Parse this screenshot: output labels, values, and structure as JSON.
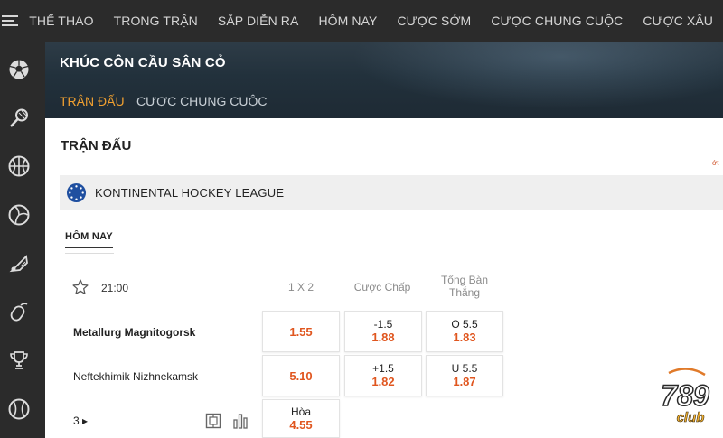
{
  "topnav": {
    "items": [
      "THỂ THAO",
      "TRONG TRẬN",
      "SẮP DIỄN RA",
      "HÔM NAY",
      "CƯỢC SỚM",
      "CƯỢC CHUNG CUỘC",
      "CƯỢC XÂU"
    ]
  },
  "sidebar": {
    "icons": [
      "soccer-ball-icon",
      "badminton-racket-icon",
      "basketball-icon",
      "volleyball-icon",
      "shuttlecock-icon",
      "computer-mouse-icon",
      "trophy-icon",
      "baseball-icon"
    ]
  },
  "banner": {
    "title": "KHÚC CÔN CẦU SÂN CỎ",
    "tabs": [
      "TRẬN ĐẤU",
      "CƯỢC CHUNG CUỘC"
    ]
  },
  "section": {
    "title": "TRẬN ĐẤU",
    "right_mark": "ớt"
  },
  "league": {
    "name": "KONTINENTAL HOCKEY LEAGUE"
  },
  "filter": {
    "today": "HÔM NAY"
  },
  "match": {
    "time": "21:00",
    "columns": {
      "c1": "1 X 2",
      "c2": "Cược Chấp",
      "c3_line1": "Tổng Bàn",
      "c3_line2": "Thắng"
    },
    "home": {
      "name": "Metallurg Magnitogorsk",
      "odds_1x2": "1.55",
      "hcap_line": "-1.5",
      "hcap_odds": "1.88",
      "total_line": "O 5.5",
      "total_odds": "1.83"
    },
    "away": {
      "name": "Neftekhimik Nizhnekamsk",
      "odds_1x2": "5.10",
      "hcap_line": "+1.5",
      "hcap_odds": "1.82",
      "total_line": "U 5.5",
      "total_odds": "1.87"
    },
    "draw": {
      "label": "Hòa",
      "odds": "4.55"
    },
    "more": "3 ▸"
  },
  "brand": {
    "logo_text": "789",
    "logo_sub": "club"
  },
  "colors": {
    "accent_orange": "#e0561f",
    "tab_active": "#f0a030",
    "sidebar_bg": "#2b2b2b"
  }
}
